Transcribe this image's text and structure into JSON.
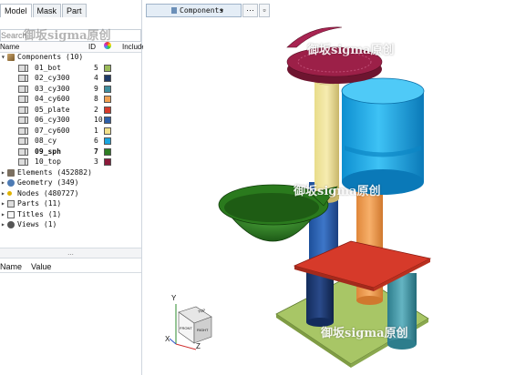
{
  "tabs": [
    "Model",
    "Mask",
    "Part"
  ],
  "search": {
    "placeholder": "Search"
  },
  "columns": {
    "name": "Name",
    "id": "ID",
    "include": "Include"
  },
  "components_root": {
    "label": "Components (10)"
  },
  "components": [
    {
      "label": "01_bot",
      "id": "5",
      "color": "#9bbb59",
      "bold": false
    },
    {
      "label": "02_cy300",
      "id": "4",
      "color": "#1f3a68",
      "bold": false
    },
    {
      "label": "03_cy300",
      "id": "9",
      "color": "#3f8fa0",
      "bold": false
    },
    {
      "label": "04_cy600",
      "id": "8",
      "color": "#f0a050",
      "bold": false
    },
    {
      "label": "05_plate",
      "id": "2",
      "color": "#d63a2a",
      "bold": false
    },
    {
      "label": "06_cy300",
      "id": "10",
      "color": "#2e5fa8",
      "bold": false
    },
    {
      "label": "07_cy600",
      "id": "1",
      "color": "#f2e08a",
      "bold": false
    },
    {
      "label": "08_cy",
      "id": "6",
      "color": "#1aa6e0",
      "bold": false
    },
    {
      "label": "09_sph",
      "id": "7",
      "color": "#2e7d23",
      "bold": true
    },
    {
      "label": "10_top",
      "id": "3",
      "color": "#8b1a3a",
      "bold": false
    }
  ],
  "other_nodes": [
    {
      "label": "Elements (452882)",
      "icon": "elements-icon"
    },
    {
      "label": "Geometry (349)",
      "icon": "geometry-icon"
    },
    {
      "label": "Nodes (480727)",
      "icon": "nodes-icon"
    },
    {
      "label": "Parts (11)",
      "icon": "parts-icon"
    },
    {
      "label": "Titles (1)",
      "icon": "titles-icon"
    },
    {
      "label": "Views (1)",
      "icon": "views-icon"
    }
  ],
  "splitter_dots": "...",
  "properties": {
    "name": "Name",
    "value": "Value"
  },
  "toolbar": {
    "combo_label": "Components",
    "combo_arrow": "▾",
    "btn_more": "···",
    "btn_pin": "▫"
  },
  "axes": {
    "y": "Y",
    "x": "X",
    "z": "Z",
    "cube_front": "RIGHT",
    "cube_top": "TOP",
    "cube_left": "FRONT"
  },
  "watermark": "御坂sigma原创"
}
